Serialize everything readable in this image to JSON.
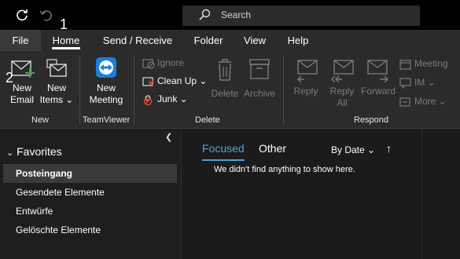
{
  "titlebar": {
    "search_placeholder": "Search"
  },
  "menu": {
    "tabs": [
      {
        "label": "File"
      },
      {
        "label": "Home"
      },
      {
        "label": "Send / Receive"
      },
      {
        "label": "Folder"
      },
      {
        "label": "View"
      },
      {
        "label": "Help"
      }
    ]
  },
  "annotations": {
    "one": "1",
    "two": "2"
  },
  "ribbon": {
    "new_email": "New\nEmail",
    "new_items": "New\nItems ⌄",
    "new_meeting": "New\nMeeting",
    "ignore": "Ignore",
    "clean_up": "Clean Up ⌄",
    "junk": "Junk ⌄",
    "delete": "Delete",
    "archive": "Archive",
    "reply": "Reply",
    "reply_all": "Reply\nAll",
    "forward": "Forward",
    "meeting": "Meeting",
    "im": "IM ⌄",
    "more": "More ⌄",
    "groups": {
      "new": "New",
      "teamviewer": "TeamViewer",
      "delete": "Delete",
      "respond": "Respond"
    }
  },
  "nav": {
    "favorites_header": "Favorites",
    "items": [
      {
        "label": "Posteingang"
      },
      {
        "label": "Gesendete Elemente"
      },
      {
        "label": "Entwürfe"
      },
      {
        "label": "Gelöschte Elemente"
      }
    ]
  },
  "messages": {
    "tab_focused": "Focused",
    "tab_other": "Other",
    "sort_label": "By Date ⌄",
    "sort_arrow": "↑",
    "empty_text": "We didn't find anything to show here."
  },
  "colors": {
    "accent": "#4aa3df",
    "titlebar": "#000000",
    "ribbon": "#2b2b2b",
    "selected": "#3a3a3a"
  },
  "icons": [
    "sync-icon",
    "undo-icon",
    "search-icon",
    "new-email-icon",
    "new-items-icon",
    "teamviewer-icon",
    "ignore-icon",
    "clean-up-icon",
    "junk-icon",
    "delete-icon",
    "archive-icon",
    "reply-icon",
    "reply-all-icon",
    "forward-icon",
    "meeting-icon",
    "im-icon",
    "more-icon"
  ]
}
